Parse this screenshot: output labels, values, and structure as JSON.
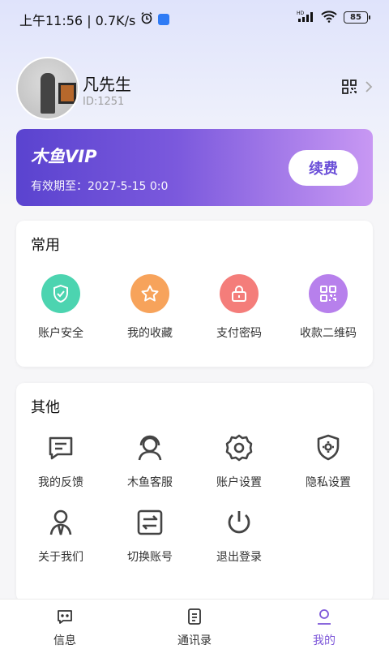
{
  "status_bar": {
    "time_and_speed": "上午11:56 | 0.7K/s",
    "network_badge": "HD",
    "battery": "85"
  },
  "profile": {
    "name": "凡先生",
    "id": "ID:1251"
  },
  "vip": {
    "title": "木鱼VIP",
    "expiry": "有效期至：2027-5-15 0:0",
    "renew_label": "续费"
  },
  "common": {
    "title": "常用",
    "items": [
      {
        "label": "账户安全",
        "icon": "shield-check-icon",
        "color": "#4cd4b0"
      },
      {
        "label": "我的收藏",
        "icon": "star-icon",
        "color": "#f7a35b"
      },
      {
        "label": "支付密码",
        "icon": "lock-icon",
        "color": "#f47d7a"
      },
      {
        "label": "收款二维码",
        "icon": "qr-code-icon",
        "color": "#b780ec"
      }
    ]
  },
  "other": {
    "title": "其他",
    "items": [
      {
        "label": "我的反馈",
        "icon": "feedback-icon"
      },
      {
        "label": "木鱼客服",
        "icon": "customer-service-icon"
      },
      {
        "label": "账户设置",
        "icon": "gear-icon"
      },
      {
        "label": "隐私设置",
        "icon": "privacy-shield-icon"
      },
      {
        "label": "关于我们",
        "icon": "about-us-icon"
      },
      {
        "label": "切换账号",
        "icon": "switch-account-icon"
      },
      {
        "label": "退出登录",
        "icon": "power-icon"
      }
    ]
  },
  "bottom_nav": {
    "items": [
      {
        "label": "信息",
        "icon": "message-icon"
      },
      {
        "label": "通讯录",
        "icon": "contacts-icon"
      },
      {
        "label": "我的",
        "icon": "profile-icon",
        "active": true
      }
    ]
  },
  "colors": {
    "accent": "#7d57d9",
    "vip_gradient_start": "#5a43cf",
    "vip_gradient_end": "#c898f3"
  }
}
